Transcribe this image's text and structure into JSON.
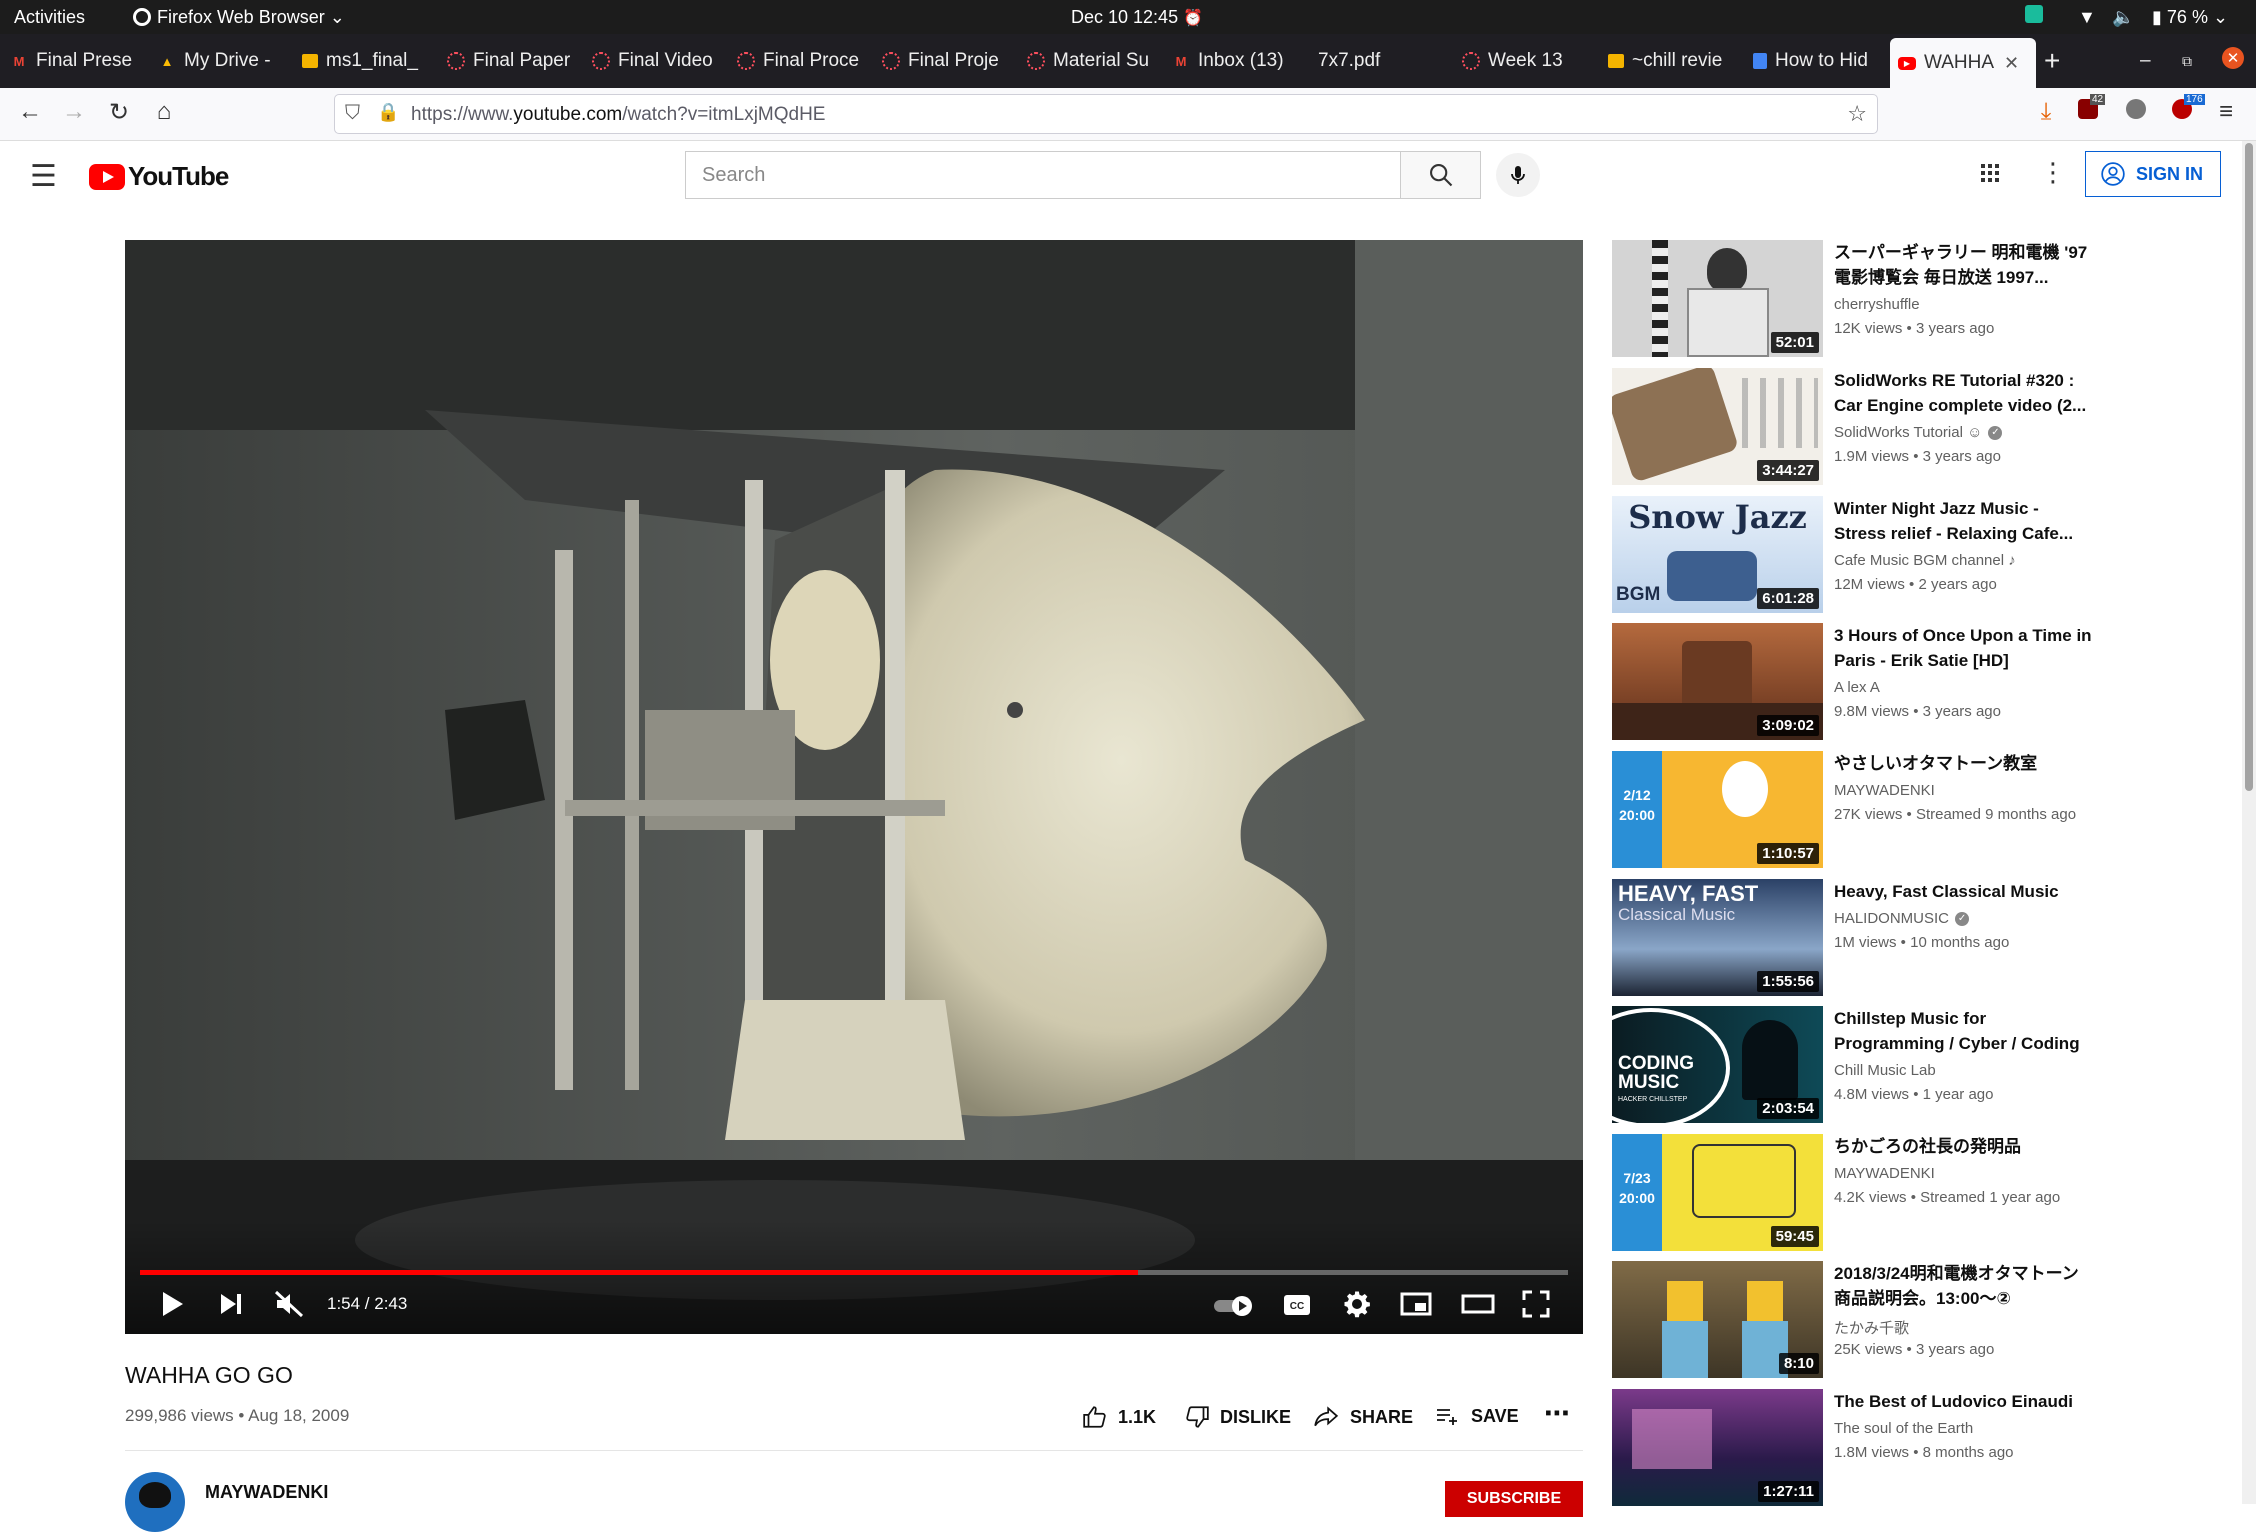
{
  "system": {
    "activities": "Activities",
    "app_name": "Firefox Web Browser",
    "datetime": "Dec 10  12:45",
    "battery": "76 %"
  },
  "tabs": [
    {
      "label": "Final Prese",
      "icon": "gmail-icon"
    },
    {
      "label": "My Drive - ",
      "icon": "drive-icon"
    },
    {
      "label": "ms1_final_",
      "icon": "slides-icon"
    },
    {
      "label": "Final Paper",
      "icon": "loading-icon"
    },
    {
      "label": "Final Video",
      "icon": "loading-icon"
    },
    {
      "label": "Final Proce",
      "icon": "loading-icon"
    },
    {
      "label": "Final Proje",
      "icon": "loading-icon"
    },
    {
      "label": "Material Su",
      "icon": "loading-icon"
    },
    {
      "label": "Inbox (13)",
      "icon": "gmail-icon"
    },
    {
      "label": "7x7.pdf",
      "icon": "pdf-icon"
    },
    {
      "label": "Week 13",
      "icon": "loading-icon"
    },
    {
      "label": "~chill revie",
      "icon": "slides-icon"
    },
    {
      "label": "How to Hid",
      "icon": "docs-icon"
    },
    {
      "label": "WAHHA",
      "icon": "youtube-icon",
      "active": true
    }
  ],
  "navbar": {
    "url_prefix": "https://www.",
    "url_domain": "youtube.com",
    "url_path": "/watch?v=itmLxjMQdHE",
    "ext_badge_1": "42",
    "ext_badge_2": "176"
  },
  "youtube": {
    "logo_text": "YouTube",
    "search_placeholder": "Search",
    "signin_label": "SIGN IN"
  },
  "player": {
    "time": "1:54 / 2:43",
    "progress_fraction": 0.699
  },
  "video": {
    "title": "WAHHA GO GO",
    "meta": "299,986 views • Aug 18, 2009",
    "likes": "1.1K",
    "dislike_label": "DISLIKE",
    "share_label": "SHARE",
    "save_label": "SAVE",
    "channel_name": "MAYWADENKI",
    "subscribe_label": "SUBSCRIBE"
  },
  "related": [
    {
      "title": "スーパーギャラリー 明和電機 '97電影博覧会 毎日放送 1997...",
      "channel": "cherryshuffle",
      "meta": "12K views • 3 years ago",
      "duration": "52:01",
      "thumb_color": "#c9c9c9"
    },
    {
      "title": "SolidWorks RE Tutorial #320 : Car Engine complete video (2...",
      "channel": "SolidWorks Tutorial ☺",
      "verified": true,
      "meta": "1.9M views • 3 years ago",
      "duration": "3:44:27",
      "thumb_color": "#e8e4de"
    },
    {
      "title": "Winter Night Jazz Music - Stress relief - Relaxing Cafe...",
      "channel": "Cafe Music BGM channel ♪",
      "meta": "12M views • 2 years ago",
      "duration": "6:01:28",
      "thumb_color": "#c8dcef",
      "thumb_text": "Snow Jazz",
      "thumb_sub": "BGM"
    },
    {
      "title": "3 Hours of Once Upon a Time in Paris - Erik Satie [HD]",
      "channel": "A lex A",
      "meta": "9.8M views • 3 years ago",
      "duration": "3:09:02",
      "thumb_color": "#8a4b2c"
    },
    {
      "title": "やさしいオタマトーン教室",
      "channel": "MAYWADENKI",
      "meta": "27K views • Streamed 9 months ago",
      "duration": "1:10:57",
      "thumb_color": "#f5a623",
      "thumb_side": "2/12\n20:00"
    },
    {
      "title": "Heavy, Fast Classical Music",
      "channel": "HALIDONMUSIC",
      "verified": true,
      "meta": "1M views • 10 months ago",
      "duration": "1:55:56",
      "thumb_color": "#3b5a86",
      "thumb_text": "HEAVY, FAST",
      "thumb_sub": "Classical Music"
    },
    {
      "title": "Chillstep Music for Programming / Cyber / Coding",
      "channel": "Chill Music Lab",
      "meta": "4.8M views • 1 year ago",
      "duration": "2:03:54",
      "thumb_color": "#0d2a33",
      "thumb_text": "CODING MUSIC",
      "thumb_sub": "HACKER CHILLSTEP"
    },
    {
      "title": "ちかごろの社長の発明品",
      "channel": "MAYWADENKI",
      "meta": "4.2K views • Streamed 1 year ago",
      "duration": "59:45",
      "thumb_color": "#f3e03a",
      "thumb_side": "7/23\n20:00"
    },
    {
      "title": "2018/3/24明和電機オタマトーン商品説明会。13:00〜②",
      "channel": "たかみ千歌",
      "meta": "25K views • 3 years ago",
      "duration": "8:10",
      "thumb_color": "#7a6a4a"
    },
    {
      "title": "The Best of Ludovico Einaudi",
      "channel": "The soul of the Earth",
      "meta": "1.8M views • 8 months ago",
      "duration": "1:27:11",
      "thumb_color": "#4a2c6a"
    }
  ]
}
